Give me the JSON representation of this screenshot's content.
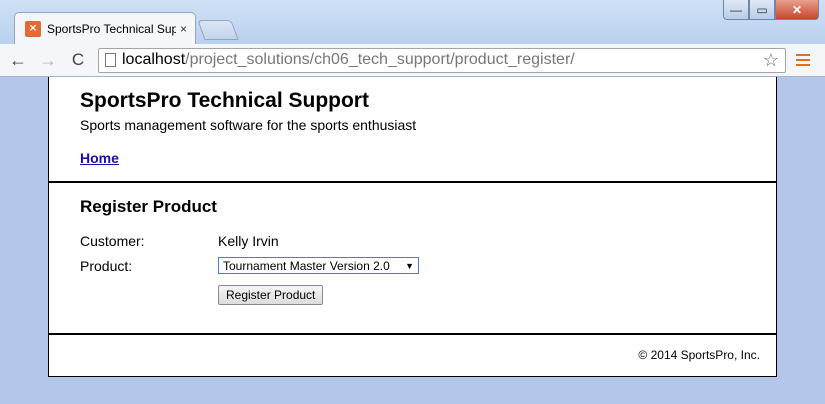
{
  "browser": {
    "tab_title": "SportsPro Technical Suppo",
    "tab_close": "×",
    "favicon": "xampp-favicon-icon",
    "url_host": "localhost",
    "url_path": "/project_solutions/ch06_tech_support/product_register/",
    "back": "←",
    "forward": "→",
    "reload": "C",
    "star": "☆",
    "win_min": "—",
    "win_max": "▭",
    "win_close": "✕"
  },
  "site": {
    "title": "SportsPro Technical Support",
    "tagline": "Sports management software for the sports enthusiast",
    "home_link": "Home"
  },
  "main": {
    "heading": "Register Product",
    "customer_label": "Customer:",
    "customer_value": "Kelly Irvin",
    "product_label": "Product:",
    "product_selected": "Tournament Master Version 2.0",
    "submit_label": "Register Product"
  },
  "footer": {
    "copyright": "© 2014 SportsPro, Inc."
  },
  "colors": {
    "page_background": "#b4c6e9",
    "link": "#1a0dab",
    "select_border": "#4a7fc7",
    "menu_accent": "#e0701a"
  }
}
